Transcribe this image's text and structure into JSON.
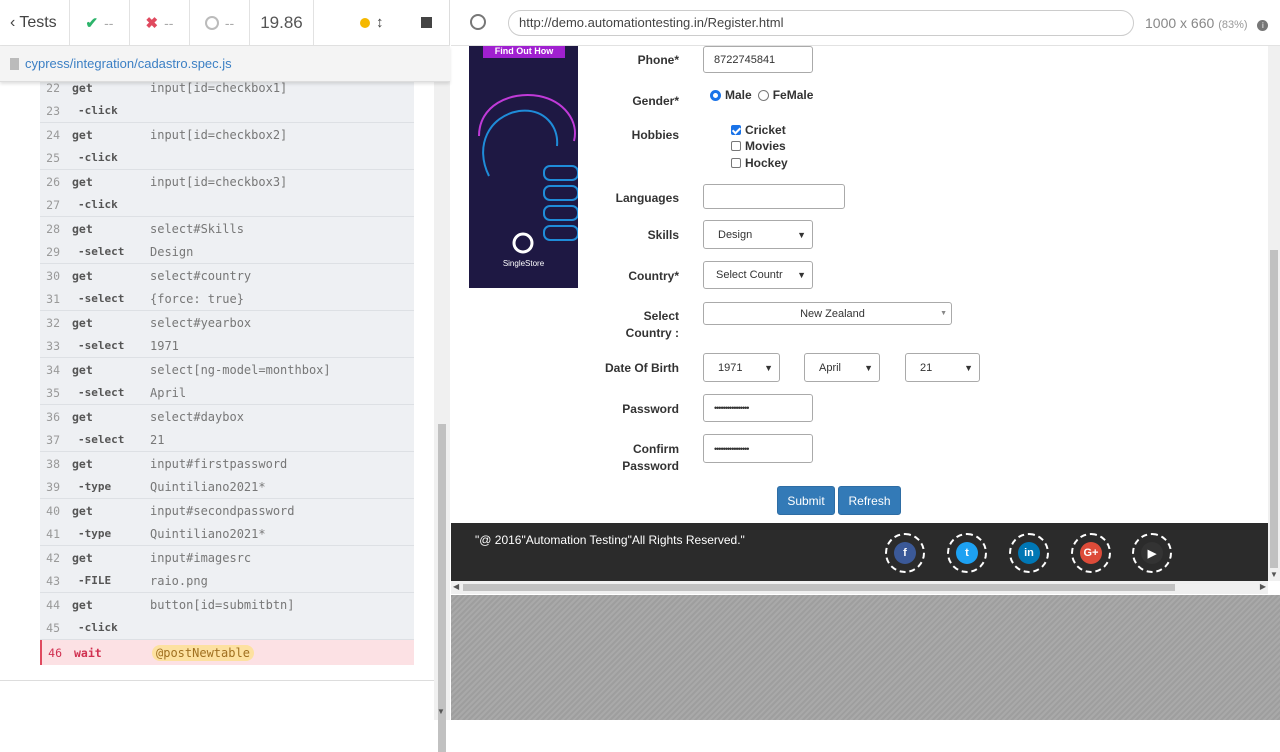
{
  "runner": {
    "tests_label": "Tests",
    "passed": "--",
    "failed": "--",
    "pending": "--",
    "duration": "19.86",
    "spec_path": "cypress/integration/cadastro.spec.js"
  },
  "commands": [
    {
      "num": "22",
      "name": "get",
      "msg": "input[id=checkbox1]",
      "child": false
    },
    {
      "num": "23",
      "name": "-click",
      "msg": "",
      "child": true
    },
    {
      "num": "24",
      "name": "get",
      "msg": "input[id=checkbox2]",
      "child": false
    },
    {
      "num": "25",
      "name": "-click",
      "msg": "",
      "child": true
    },
    {
      "num": "26",
      "name": "get",
      "msg": "input[id=checkbox3]",
      "child": false
    },
    {
      "num": "27",
      "name": "-click",
      "msg": "",
      "child": true
    },
    {
      "num": "28",
      "name": "get",
      "msg": "select#Skills",
      "child": false
    },
    {
      "num": "29",
      "name": "-select",
      "msg": "Design",
      "child": true
    },
    {
      "num": "30",
      "name": "get",
      "msg": "select#country",
      "child": false
    },
    {
      "num": "31",
      "name": "-select",
      "msg": "{force: true}",
      "child": true
    },
    {
      "num": "32",
      "name": "get",
      "msg": "select#yearbox",
      "child": false
    },
    {
      "num": "33",
      "name": "-select",
      "msg": "1971",
      "child": true
    },
    {
      "num": "34",
      "name": "get",
      "msg": "select[ng-model=monthbox]",
      "child": false
    },
    {
      "num": "35",
      "name": "-select",
      "msg": "April",
      "child": true
    },
    {
      "num": "36",
      "name": "get",
      "msg": "select#daybox",
      "child": false
    },
    {
      "num": "37",
      "name": "-select",
      "msg": "21",
      "child": true
    },
    {
      "num": "38",
      "name": "get",
      "msg": "input#firstpassword",
      "child": false
    },
    {
      "num": "39",
      "name": "-type",
      "msg": "Quintiliano2021*",
      "child": true
    },
    {
      "num": "40",
      "name": "get",
      "msg": "input#secondpassword",
      "child": false
    },
    {
      "num": "41",
      "name": "-type",
      "msg": "Quintiliano2021*",
      "child": true
    },
    {
      "num": "42",
      "name": "get",
      "msg": "input#imagesrc",
      "child": false
    },
    {
      "num": "43",
      "name": "-FILE",
      "msg": "raio.png",
      "child": true
    },
    {
      "num": "44",
      "name": "get",
      "msg": "button[id=submitbtn]",
      "child": false
    },
    {
      "num": "45",
      "name": "-click",
      "msg": "",
      "child": true
    }
  ],
  "error_command": {
    "num": "46",
    "name": "wait",
    "alias": "@postNewtable"
  },
  "aut": {
    "url": "http://demo.automationtesting.in/Register.html",
    "viewport": "1000 x 660",
    "scale": "(83%)"
  },
  "form": {
    "ad_button": "Find Out How",
    "ad_brand": "SingleStore",
    "phone_label": "Phone*",
    "phone_value": "8722745841",
    "gender_label": "Gender*",
    "gender_male": "Male",
    "gender_female": "FeMale",
    "hobbies_label": "Hobbies",
    "hobby_cricket": "Cricket",
    "hobby_movies": "Movies",
    "hobby_hockey": "Hockey",
    "languages_label": "Languages",
    "skills_label": "Skills",
    "skills_value": "Design",
    "country_label": "Country*",
    "country_value": "Select Countr",
    "select_country_label_1": "Select",
    "select_country_label_2": "Country :",
    "select_country_value": "New Zealand",
    "dob_label": "Date Of Birth",
    "dob_year": "1971",
    "dob_month": "April",
    "dob_day": "21",
    "password_label": "Password",
    "password_value": "••••••••••••••••",
    "confirm_label_1": "Confirm",
    "confirm_label_2": "Password",
    "confirm_value": "••••••••••••••••",
    "submit_label": "Submit",
    "refresh_label": "Refresh",
    "footer_text": "\"@ 2016\"Automation Testing\"All Rights Reserved.\"",
    "social": [
      {
        "name": "facebook",
        "glyph": "f",
        "color": "#3b5998"
      },
      {
        "name": "twitter",
        "glyph": "t",
        "color": "#1da1f2"
      },
      {
        "name": "linkedin",
        "glyph": "in",
        "color": "#0077b5"
      },
      {
        "name": "google-plus",
        "glyph": "G+",
        "color": "#dd4b39"
      },
      {
        "name": "youtube",
        "glyph": "▶",
        "color": "#333333"
      }
    ]
  }
}
